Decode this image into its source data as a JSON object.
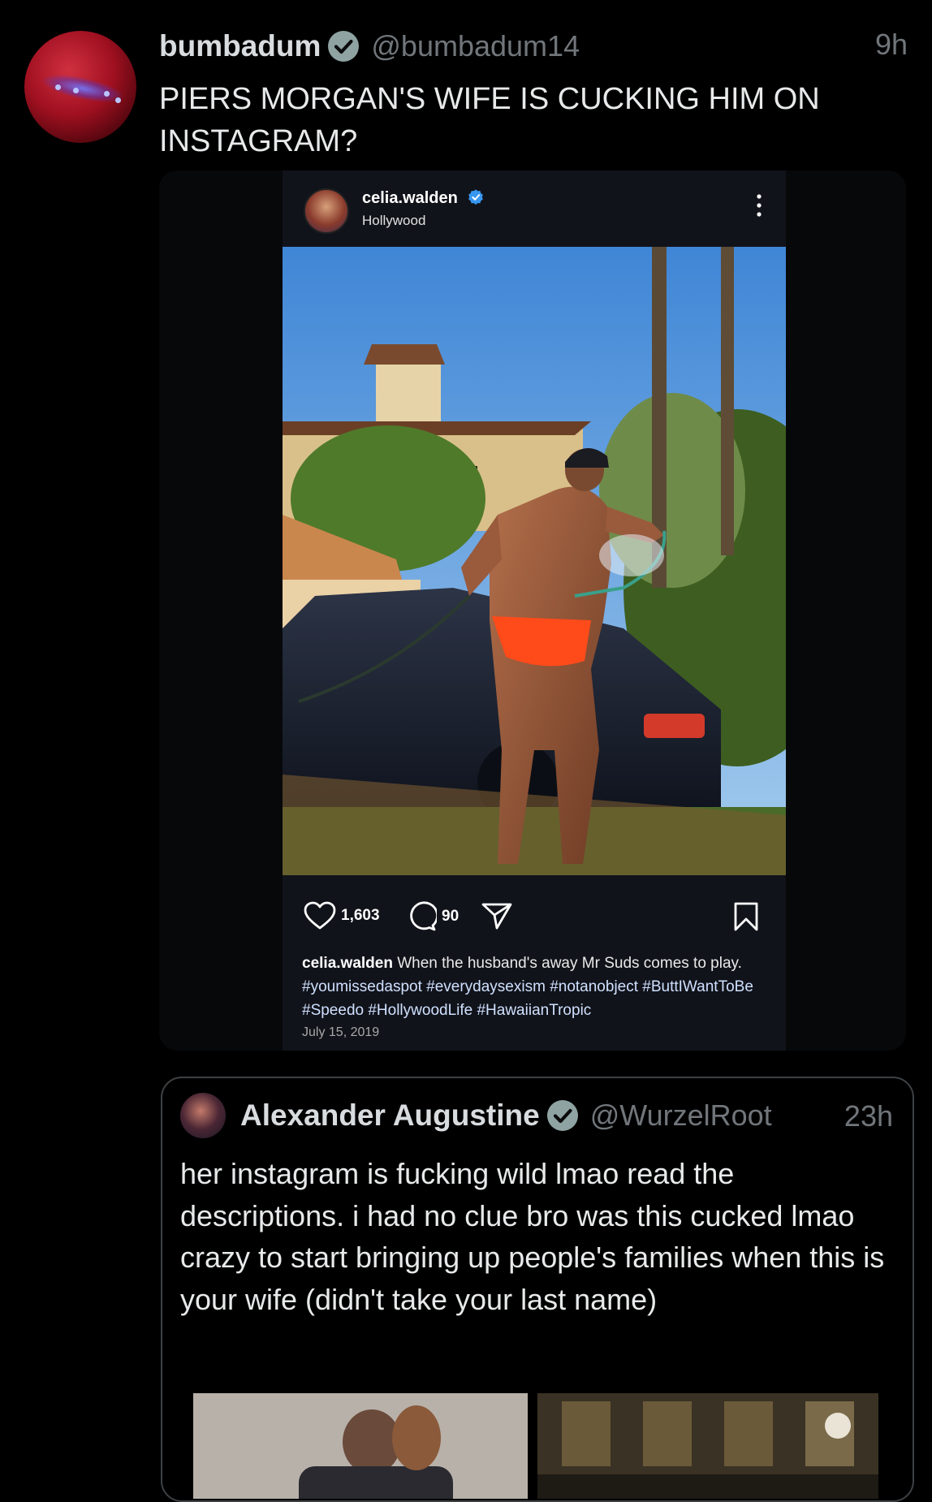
{
  "tweet": {
    "name": "bumbadum",
    "handle": "@bumbadum14",
    "time": "9h",
    "text": "PIERS MORGAN'S WIFE IS CUCKING HIM ON INSTAGRAM?"
  },
  "instagram_post": {
    "username": "celia.walden",
    "location": "Hollywood",
    "likes": "1,603",
    "comments": "90",
    "caption_user": "celia.walden",
    "caption_text": "When the husband's away Mr Suds comes to play.",
    "hashtags": "#youmissedaspot #everydaysexism #notanobject #ButtIWantToBe #Speedo #HollywoodLife #HawaiianTropic",
    "date": "July 15, 2019"
  },
  "quoted_tweet": {
    "name": "Alexander Augustine",
    "handle": "@WurzelRoot",
    "time": "23h",
    "text": "her instagram is fucking wild lmao read the descriptions. i had no clue bro was this cucked lmao crazy to start bringing up people's families when this is your wife (didn't take your last name)"
  },
  "colors": {
    "background": "#000000",
    "text": "#e7e9ea",
    "secondary_text": "#71767b",
    "verified_badge": "#8fa3a3",
    "border": "#3e4144",
    "instagram_bg": "#11131a",
    "instagram_verified": "#3897f0"
  },
  "icons": [
    "verified-icon",
    "more-icon",
    "heart-icon",
    "comment-icon",
    "share-icon",
    "bookmark-icon"
  ]
}
